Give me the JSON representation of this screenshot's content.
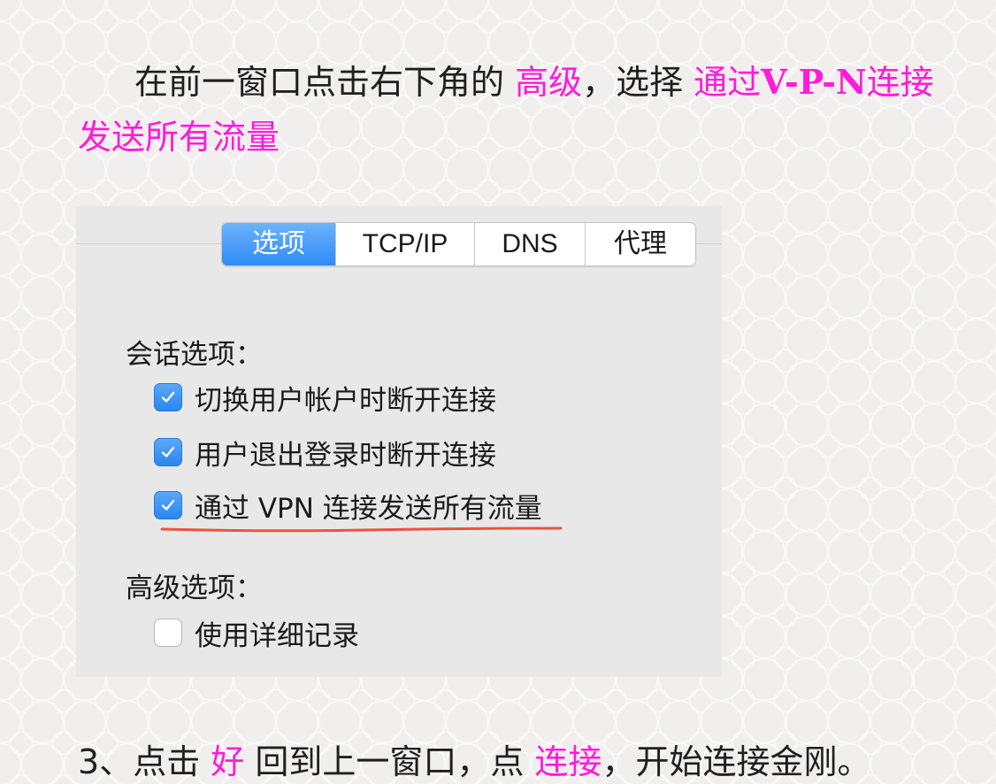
{
  "intro": {
    "line1_prefix": "在前一窗口点击右下角的 ",
    "line1_advanced": "高级",
    "line1_mid": "，选择 ",
    "line1_select_a": "通过",
    "line1_select_b": "V-P-N",
    "line1_select_c": "连接",
    "line2": "发送所有流量"
  },
  "panel": {
    "tabs": [
      "选项",
      "TCP/IP",
      "DNS",
      "代理"
    ],
    "active_tab": "选项",
    "session_heading": "会话选项：",
    "session_options": [
      {
        "label": "切换用户帐户时断开连接",
        "checked": true
      },
      {
        "label": "用户退出登录时断开连接",
        "checked": true
      },
      {
        "label": "通过 VPN 连接发送所有流量",
        "checked": true
      }
    ],
    "advanced_heading": "高级选项：",
    "advanced_options": [
      {
        "label": "使用详细记录",
        "checked": false
      }
    ],
    "highlight_color": "#e8543e",
    "accent_color": "#2d8bf7"
  },
  "step3": {
    "number": "3",
    "text_a": "、点击 ",
    "ok": "好",
    "text_b": " 回到上一窗口，点 ",
    "connect": "连接",
    "text_c": "，开始连接金刚。"
  },
  "highlight_text_color": "#ff1bd9"
}
